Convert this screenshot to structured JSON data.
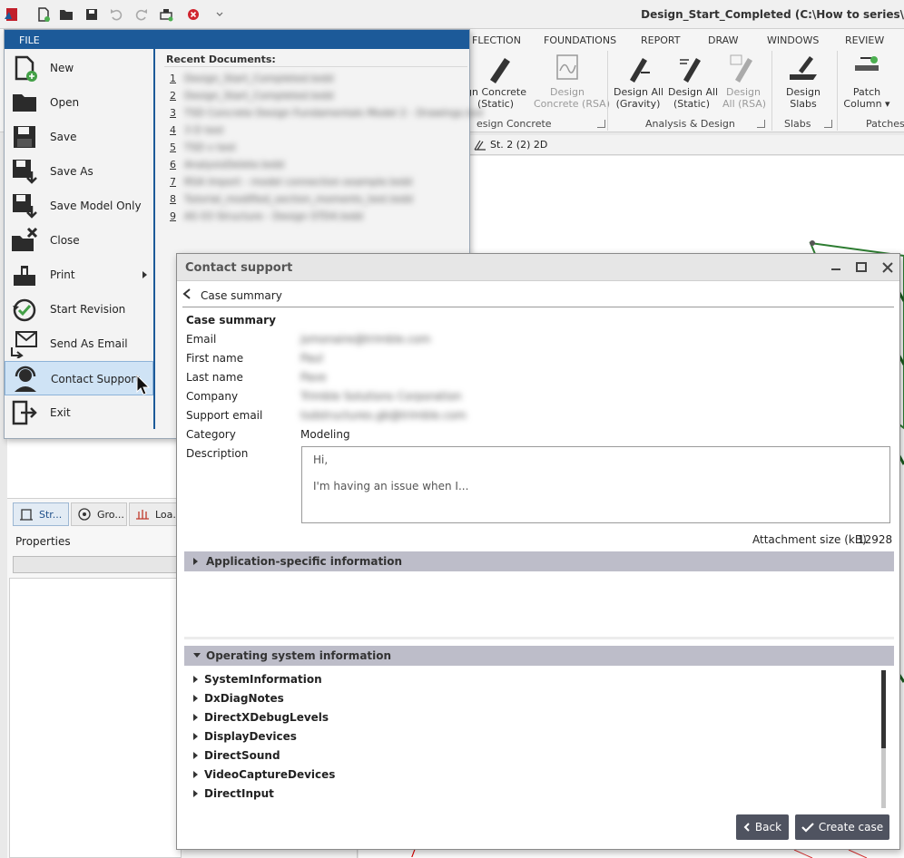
{
  "window": {
    "title": "Design_Start_Completed (C:\\How to series\\"
  },
  "ribbon": {
    "tabs": [
      "FLECTION",
      "FOUNDATIONS",
      "REPORT",
      "DRAW",
      "WINDOWS",
      "REVIEW"
    ],
    "buttons": [
      {
        "label": "gn Concrete\n(Static)",
        "disabled": false
      },
      {
        "label": "Design\nConcrete (RSA)",
        "disabled": true
      },
      {
        "label": "Design All\n(Gravity)",
        "disabled": false
      },
      {
        "label": "Design All\n(Static)",
        "disabled": false
      },
      {
        "label": "Design\nAll (RSA)",
        "disabled": true
      },
      {
        "label": "Design\nSlabs",
        "disabled": false
      },
      {
        "label": "Patch\nColumn ▾",
        "disabled": false
      }
    ],
    "groups": [
      "esign Concrete",
      "Analysis & Design",
      "Slabs",
      "Patches"
    ]
  },
  "view_tab": {
    "label": "St. 2 (2) 2D"
  },
  "viewport": {
    "marker": "7"
  },
  "left_panel": {
    "tabs": [
      "Str...",
      "Gro...",
      "Loa..."
    ],
    "properties_label": "Properties"
  },
  "file_menu": {
    "header": "FILE",
    "items": [
      {
        "label": "New",
        "icon": "new-file-icon"
      },
      {
        "label": "Open",
        "icon": "folder-icon"
      },
      {
        "label": "Save",
        "icon": "save-icon"
      },
      {
        "label": "Save As",
        "icon": "save-as-icon"
      },
      {
        "label": "Save Model Only",
        "icon": "save-model-icon"
      },
      {
        "label": "Close",
        "icon": "close-folder-icon"
      },
      {
        "label": "Print",
        "icon": "print-icon"
      },
      {
        "label": "Start Revision",
        "icon": "revision-icon"
      },
      {
        "label": "Send As Email",
        "icon": "email-icon"
      },
      {
        "label": "Contact Support",
        "icon": "headset-icon"
      },
      {
        "label": "Exit",
        "icon": "exit-icon"
      }
    ],
    "recent_title": "Recent Documents:",
    "recent": [
      {
        "num": "1",
        "text": "Design_Start_Completed.tedd"
      },
      {
        "num": "2",
        "text": "Design_Start_Completed.tedd"
      },
      {
        "num": "3",
        "text": "TSD Concrete Design Fundamentals Model 2 - Drawings.ted"
      },
      {
        "num": "4",
        "text": "3 D test"
      },
      {
        "num": "5",
        "text": "TSD v test"
      },
      {
        "num": "6",
        "text": "AnalysisDelete.tedd"
      },
      {
        "num": "7",
        "text": "RSA Import - model connection example.tedd"
      },
      {
        "num": "8",
        "text": "Tutorial_modified_section_moments_test.tedd"
      },
      {
        "num": "9",
        "text": "AS 03 Structure - Design STD4.tedd"
      }
    ]
  },
  "dialog": {
    "title": "Contact support",
    "breadcrumb": "Case summary",
    "section_title": "Case summary",
    "fields": [
      {
        "label": "Email",
        "value": "jsmonaire@trimble.com",
        "blurred": true
      },
      {
        "label": "First name",
        "value": "Paul",
        "blurred": true
      },
      {
        "label": "Last name",
        "value": "Pave",
        "blurred": true
      },
      {
        "label": "Company",
        "value": "Trimble Solutions Corporation",
        "blurred": true
      },
      {
        "label": "Support email",
        "value": "tsdstructures.gb@trimble.com",
        "blurred": true
      },
      {
        "label": "Category",
        "value": "Modeling",
        "blurred": false
      }
    ],
    "description_label": "Description",
    "description_lines": [
      "Hi,",
      "I'm having an issue when I..."
    ],
    "attachment_label": "Attachment size (kB)",
    "attachment_value": "12928",
    "app_info_header": "Application-specific information",
    "os_info_header": "Operating system information",
    "os_items": [
      "SystemInformation",
      "DxDiagNotes",
      "DirectXDebugLevels",
      "DisplayDevices",
      "DirectSound",
      "VideoCaptureDevices",
      "DirectInput"
    ],
    "back_label": "Back",
    "create_label": "Create case"
  }
}
